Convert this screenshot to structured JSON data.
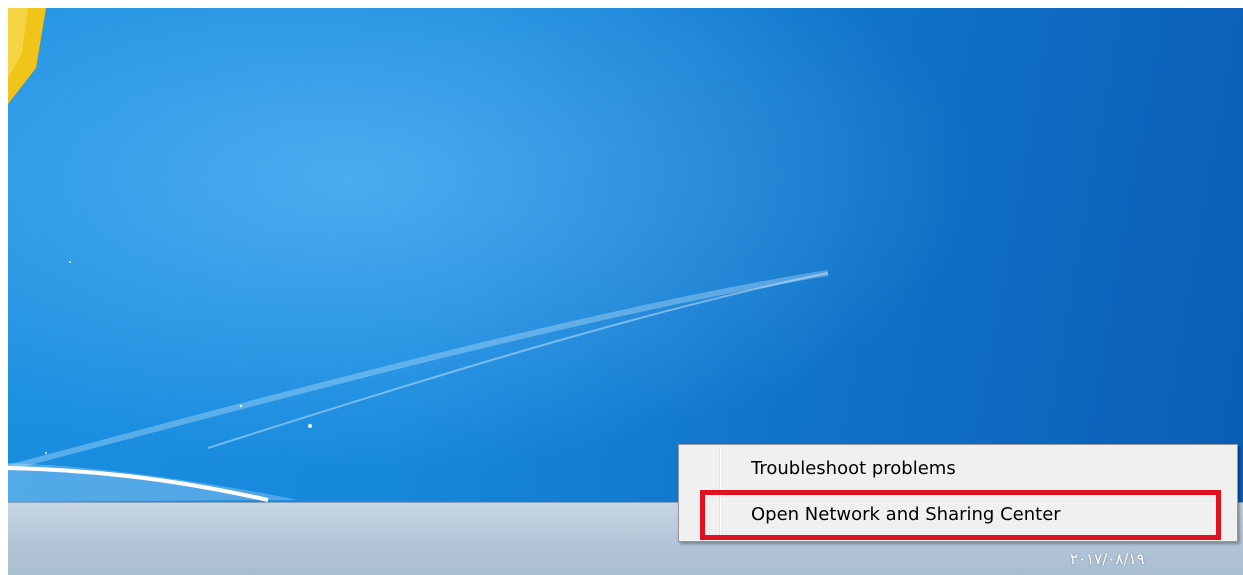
{
  "desktop": {
    "wallpaper": "windows-7-default-blue"
  },
  "context_menu": {
    "items": [
      {
        "label": "Troubleshoot problems"
      },
      {
        "label": "Open Network and Sharing Center"
      }
    ]
  },
  "annotation": {
    "highlight_color": "#e0121f",
    "highlighted_item": "Open Network and Sharing Center"
  },
  "taskbar": {
    "tray_icons": [
      "network-icon",
      "flag-icon",
      "volume-icon"
    ],
    "clock_date": "۲۰۱۷/۰۸/۱۹"
  },
  "colors": {
    "desktop_accent": "#1688dc",
    "taskbar": "#b6c8da",
    "menu_background": "#f0f0f0"
  }
}
